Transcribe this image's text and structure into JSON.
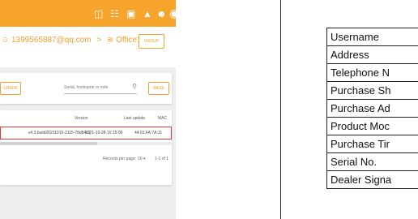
{
  "header": {
    "icons": [
      "monitor-icon",
      "grid-icon",
      "box-icon",
      "bell-icon",
      "users-icon",
      "account-icon"
    ]
  },
  "path": {
    "user": "1399565887@qq.com",
    "separator": ">",
    "group": "Office1",
    "group_button": "GROUP"
  },
  "toolbar": {
    "upgrade_label": "GRADE",
    "search_placeholder": "Serial, hostname or note",
    "base_label": "BASE"
  },
  "table": {
    "columns": [
      "Version",
      "Last update",
      "MAC"
    ],
    "row": {
      "version": "v4.3.build20211015-2115-78d84c1",
      "last_update": "2021-10-28 10:15:00",
      "mac": "44:01:FA:7A:11"
    }
  },
  "footer": {
    "records_label": "Records per page:",
    "per_page": "10",
    "range": "1-1 of 1"
  },
  "form": {
    "rows": [
      "Username",
      "Address",
      "Telephone N",
      "Purchase Sh",
      "Purchase Ad",
      "Product Moc",
      "Purchase Tir",
      "Serial No.",
      "Dealer Signa"
    ]
  },
  "colors": {
    "accent": "#f7a42c",
    "highlight": "#e53935"
  }
}
